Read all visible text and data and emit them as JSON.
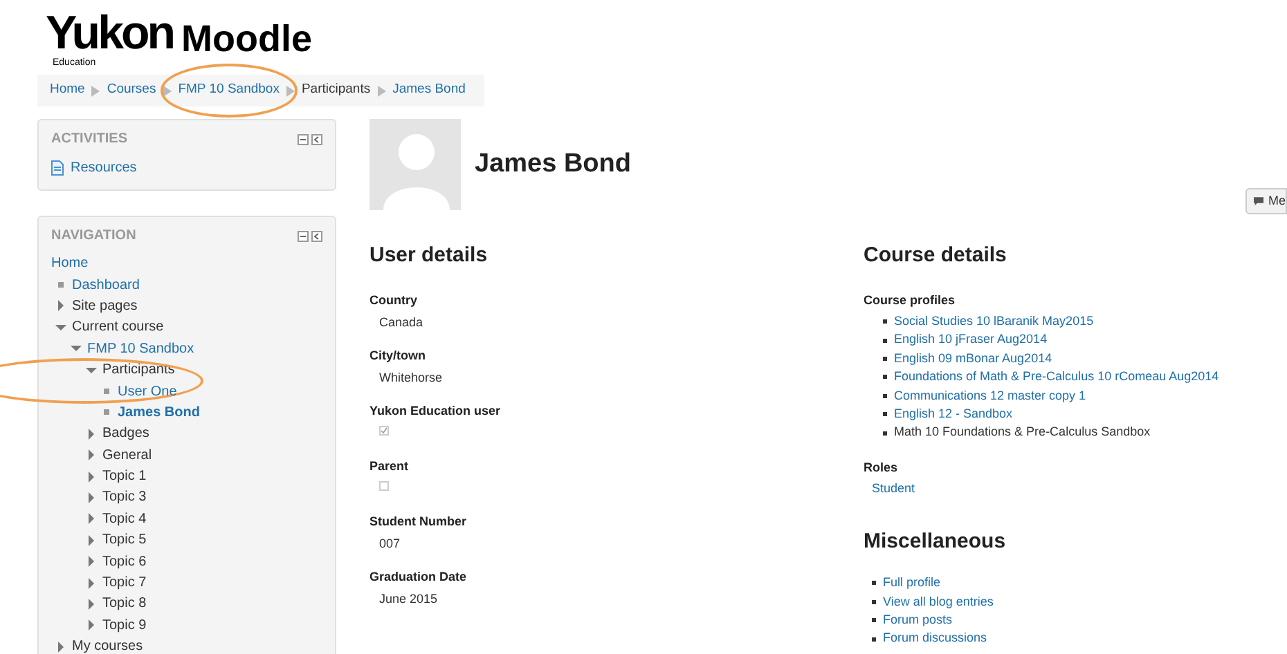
{
  "logo": {
    "brand": "Yukon",
    "sub": "Education",
    "product": "Moodle"
  },
  "breadcrumb": [
    {
      "label": "Home",
      "highlighted": false
    },
    {
      "label": "Courses",
      "highlighted": false
    },
    {
      "label": "FMP 10 Sandbox",
      "highlighted": true
    },
    {
      "label": "Participants",
      "highlighted": false
    },
    {
      "label": "James Bond",
      "highlighted": false
    }
  ],
  "activities": {
    "title": "ACTIVITIES",
    "items": [
      {
        "label": "Resources"
      }
    ]
  },
  "navigation": {
    "title": "NAVIGATION",
    "items": [
      {
        "label": "Home",
        "kind": "root"
      },
      {
        "label": "Dashboard",
        "kind": "leaf",
        "link": true
      },
      {
        "label": "Site pages",
        "kind": "branch",
        "expanded": false
      },
      {
        "label": "Current course",
        "kind": "branch",
        "expanded": true,
        "children": [
          {
            "label": "FMP 10 Sandbox",
            "kind": "branch",
            "expanded": true,
            "link": true,
            "children": [
              {
                "label": "Participants",
                "kind": "branch",
                "expanded": true,
                "highlighted": true,
                "children": [
                  {
                    "label": "User One",
                    "kind": "leaf",
                    "link": true,
                    "selected": false
                  },
                  {
                    "label": "James Bond",
                    "kind": "leaf",
                    "link": true,
                    "selected": true
                  }
                ]
              },
              {
                "label": "Badges",
                "kind": "branch",
                "expanded": false
              },
              {
                "label": "General",
                "kind": "branch",
                "expanded": false
              },
              {
                "label": "Topic 1",
                "kind": "branch",
                "expanded": false
              },
              {
                "label": "Topic 3",
                "kind": "branch",
                "expanded": false
              },
              {
                "label": "Topic 4",
                "kind": "branch",
                "expanded": false
              },
              {
                "label": "Topic 5",
                "kind": "branch",
                "expanded": false
              },
              {
                "label": "Topic 6",
                "kind": "branch",
                "expanded": false
              },
              {
                "label": "Topic 7",
                "kind": "branch",
                "expanded": false
              },
              {
                "label": "Topic 8",
                "kind": "branch",
                "expanded": false
              },
              {
                "label": "Topic 9",
                "kind": "branch",
                "expanded": false
              }
            ]
          }
        ]
      },
      {
        "label": "My courses",
        "kind": "branch",
        "expanded": false
      }
    ]
  },
  "profile": {
    "name": "James Bond",
    "message_button": "Me"
  },
  "user_details": {
    "title": "User details",
    "fields": [
      {
        "label": "Country",
        "value": "Canada",
        "kind": "text"
      },
      {
        "label": "City/town",
        "value": "Whitehorse",
        "kind": "text"
      },
      {
        "label": "Yukon Education user",
        "kind": "checkbox",
        "checked": true
      },
      {
        "label": "Parent",
        "kind": "checkbox",
        "checked": false
      },
      {
        "label": "Student Number",
        "value": "007",
        "kind": "text"
      },
      {
        "label": "Graduation Date",
        "value": "June 2015",
        "kind": "text"
      }
    ]
  },
  "course_details": {
    "title": "Course details",
    "profiles_label": "Course profiles",
    "profiles": [
      {
        "label": "Social Studies 10 lBaranik May2015",
        "link": true
      },
      {
        "label": "English 10 jFraser Aug2014",
        "link": true
      },
      {
        "label": "English 09 mBonar Aug2014",
        "link": true
      },
      {
        "label": "Foundations of Math & Pre-Calculus 10 rComeau Aug2014",
        "link": true
      },
      {
        "label": "Communications 12 master copy 1",
        "link": true
      },
      {
        "label": "English 12 - Sandbox",
        "link": true
      },
      {
        "label": "Math 10 Foundations & Pre-Calculus Sandbox",
        "link": false
      }
    ],
    "roles_label": "Roles",
    "roles": [
      "Student"
    ]
  },
  "miscellaneous": {
    "title": "Miscellaneous",
    "links": [
      "Full profile",
      "View all blog entries",
      "Forum posts",
      "Forum discussions"
    ]
  }
}
